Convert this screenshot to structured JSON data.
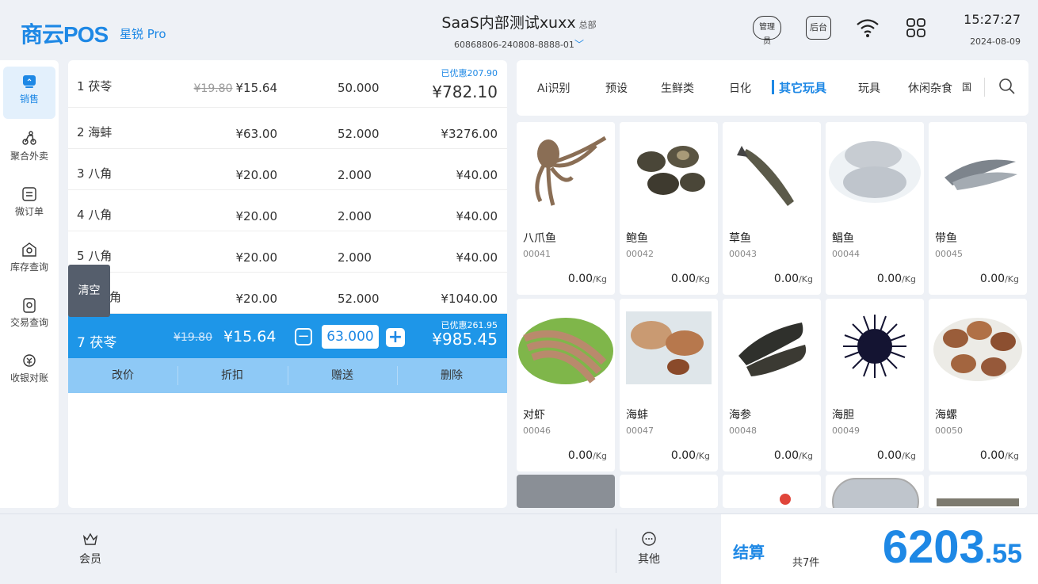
{
  "header": {
    "logo": "商云POS",
    "logo_sub": "星锐 Pro",
    "store_name": "SaaS内部测试xuxx",
    "store_tag": "总部",
    "store_code": "60868806-240808-8888-01",
    "admin_label": "管理员",
    "backend_label": "后台",
    "time": "15:27:27",
    "date": "2024-08-09"
  },
  "nav": {
    "items": [
      {
        "label": "销售",
        "icon": "sales-icon"
      },
      {
        "label": "聚合外卖",
        "icon": "delivery-icon"
      },
      {
        "label": "微订单",
        "icon": "order-icon"
      },
      {
        "label": "库存查询",
        "icon": "inventory-icon"
      },
      {
        "label": "交易查询",
        "icon": "transaction-icon"
      },
      {
        "label": "收银对账",
        "icon": "reconcile-icon"
      }
    ]
  },
  "cart": {
    "rows": [
      {
        "name": "1  茯苓",
        "orig": "¥19.80",
        "price": "¥15.64",
        "qty": "50.000",
        "discount": "已优惠207.90",
        "total": "¥782.10"
      },
      {
        "name": "2  海蚌",
        "price": "¥63.00",
        "qty": "52.000",
        "total": "¥3276.00"
      },
      {
        "name": "3  八角",
        "price": "¥20.00",
        "qty": "2.000",
        "total": "¥40.00"
      },
      {
        "name": "4  八角",
        "price": "¥20.00",
        "qty": "2.000",
        "total": "¥40.00"
      },
      {
        "name": "5  八角",
        "price": "¥20.00",
        "qty": "2.000",
        "total": "¥40.00"
      },
      {
        "name": "角",
        "price": "¥20.00",
        "qty": "52.000",
        "total": "¥1040.00"
      }
    ],
    "selected": {
      "name": "7  茯苓",
      "orig": "¥19.80",
      "price": "¥15.64",
      "qty": "63.000",
      "discount": "已优惠261.95",
      "total": "¥985.45"
    },
    "actions": [
      "改价",
      "折扣",
      "赠送",
      "删除"
    ],
    "clear_label": "清空"
  },
  "categories": {
    "items": [
      "Ai识别",
      "预设",
      "生鲜类",
      "日化",
      "其它玩具",
      "玩具",
      "休闲杂食",
      "国"
    ],
    "active": "其它玩具"
  },
  "products": [
    {
      "name": "八爪鱼",
      "code": "00041",
      "price": "0.00",
      "unit": "/Kg"
    },
    {
      "name": "鲍鱼",
      "code": "00042",
      "price": "0.00",
      "unit": "/Kg"
    },
    {
      "name": "草鱼",
      "code": "00043",
      "price": "0.00",
      "unit": "/Kg"
    },
    {
      "name": "鲳鱼",
      "code": "00044",
      "price": "0.00",
      "unit": "/Kg"
    },
    {
      "name": "带鱼",
      "code": "00045",
      "price": "0.00",
      "unit": "/Kg"
    },
    {
      "name": "对虾",
      "code": "00046",
      "price": "0.00",
      "unit": "/Kg"
    },
    {
      "name": "海蚌",
      "code": "00047",
      "price": "0.00",
      "unit": "/Kg"
    },
    {
      "name": "海参",
      "code": "00048",
      "price": "0.00",
      "unit": "/Kg"
    },
    {
      "name": "海胆",
      "code": "00049",
      "price": "0.00",
      "unit": "/Kg"
    },
    {
      "name": "海螺",
      "code": "00050",
      "price": "0.00",
      "unit": "/Kg"
    }
  ],
  "footer": {
    "member_label": "会员",
    "other_label": "其他",
    "checkout_label": "结算",
    "count_label": "共7件",
    "amount_int": "6203",
    "amount_dec": ".55"
  },
  "colors": {
    "accent": "#1e88e5",
    "selected_row": "#1e96e8",
    "action_bar": "#8ec9f6"
  }
}
